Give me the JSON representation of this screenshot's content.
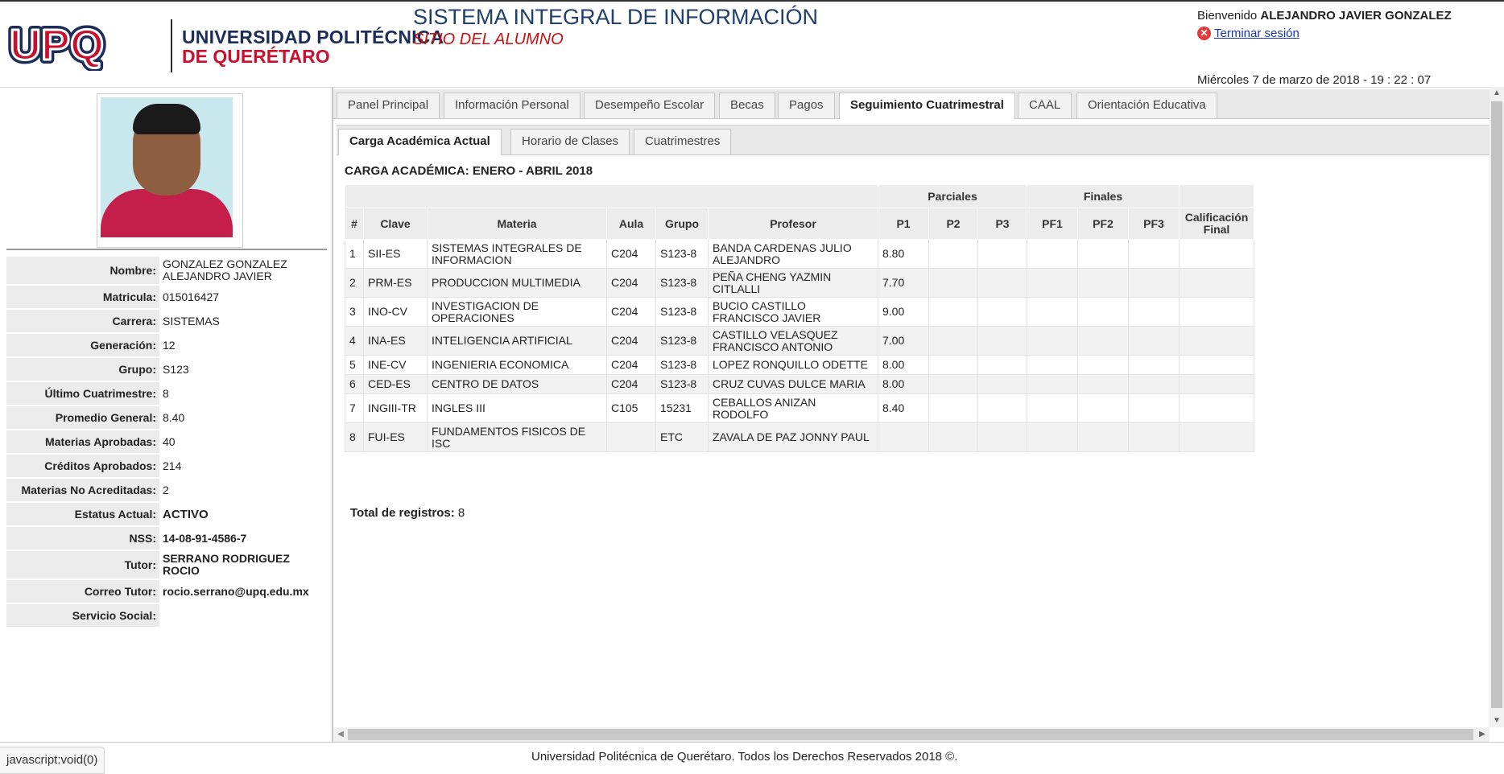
{
  "header": {
    "logo_upq": "UPQ",
    "logo_line1": "UNIVERSIDAD POLITÉCNICA",
    "logo_line2": "DE QUERÉTARO",
    "system_title": "SISTEMA INTEGRAL DE INFORMACIÓN",
    "system_subtitle": "SITIO DEL ALUMNO",
    "welcome_label": "Bienvenido",
    "welcome_user": "ALEJANDRO JAVIER GONZALEZ",
    "logout_label": "Terminar sesión",
    "datetime": "Miércoles 7 de marzo de 2018 - 19 : 22 : 07",
    "colors": {
      "title": "#1f3f6e",
      "subtitle": "#cc1111",
      "brand_red": "#c8102e",
      "brand_navy": "#1c2d5a"
    }
  },
  "profile": {
    "fields": [
      {
        "label": "Nombre:",
        "value": "GONZALEZ GONZALEZ ALEJANDRO JAVIER"
      },
      {
        "label": "Matricula:",
        "value": "015016427"
      },
      {
        "label": "Carrera:",
        "value": "SISTEMAS"
      },
      {
        "label": "Generación:",
        "value": "12"
      },
      {
        "label": "Grupo:",
        "value": "S123"
      },
      {
        "label": "Último Cuatrimestre:",
        "value": "8"
      },
      {
        "label": "Promedio General:",
        "value": "8.40"
      },
      {
        "label": "Materias Aprobadas:",
        "value": "40"
      },
      {
        "label": "Créditos Aprobados:",
        "value": "214"
      },
      {
        "label": "Materias No Acreditadas:",
        "value": "2"
      },
      {
        "label": "Estatus Actual:",
        "value": "ACTIVO"
      },
      {
        "label": "NSS:",
        "value": "14-08-91-4586-7"
      },
      {
        "label": "Tutor:",
        "value": "SERRANO RODRIGUEZ ROCIO"
      },
      {
        "label": "Correo Tutor:",
        "value": "rocio.serrano@upq.edu.mx"
      },
      {
        "label": "Servicio Social:",
        "value": ""
      }
    ]
  },
  "main_tabs": [
    {
      "label": "Panel Principal"
    },
    {
      "label": "Información Personal"
    },
    {
      "label": "Desempeño Escolar"
    },
    {
      "label": "Becas"
    },
    {
      "label": "Pagos"
    },
    {
      "label": "Seguimiento Cuatrimestral",
      "active": true
    },
    {
      "label": "CAAL"
    },
    {
      "label": "Orientación Educativa"
    }
  ],
  "sub_tabs": [
    {
      "label": "Carga Académica Actual",
      "active": true
    },
    {
      "label": "Horario de Clases"
    },
    {
      "label": "Cuatrimestres"
    }
  ],
  "carga": {
    "title": "CARGA ACADÉMICA: ENERO - ABRIL 2018",
    "group_headers": {
      "parciales": "Parciales",
      "finales": "Finales"
    },
    "columns": [
      "#",
      "Clave",
      "Materia",
      "Aula",
      "Grupo",
      "Profesor",
      "P1",
      "P2",
      "P3",
      "PF1",
      "PF2",
      "PF3",
      "Calificación Final"
    ],
    "rows": [
      [
        "1",
        "SII-ES",
        "SISTEMAS INTEGRALES DE INFORMACION",
        "C204",
        "S123-8",
        "BANDA CARDENAS JULIO ALEJANDRO",
        "8.80",
        "",
        "",
        "",
        "",
        "",
        ""
      ],
      [
        "2",
        "PRM-ES",
        "PRODUCCION MULTIMEDIA",
        "C204",
        "S123-8",
        "PEÑA CHENG YAZMIN CITLALLI",
        "7.70",
        "",
        "",
        "",
        "",
        "",
        ""
      ],
      [
        "3",
        "INO-CV",
        "INVESTIGACION DE OPERACIONES",
        "C204",
        "S123-8",
        "BUCIO CASTILLO FRANCISCO JAVIER",
        "9.00",
        "",
        "",
        "",
        "",
        "",
        ""
      ],
      [
        "4",
        "INA-ES",
        "INTELIGENCIA ARTIFICIAL",
        "C204",
        "S123-8",
        "CASTILLO VELASQUEZ FRANCISCO ANTONIO",
        "7.00",
        "",
        "",
        "",
        "",
        "",
        ""
      ],
      [
        "5",
        "INE-CV",
        "INGENIERIA ECONOMICA",
        "C204",
        "S123-8",
        "LOPEZ RONQUILLO ODETTE",
        "8.00",
        "",
        "",
        "",
        "",
        "",
        ""
      ],
      [
        "6",
        "CED-ES",
        "CENTRO DE DATOS",
        "C204",
        "S123-8",
        "CRUZ CUVAS DULCE MARIA",
        "8.00",
        "",
        "",
        "",
        "",
        "",
        ""
      ],
      [
        "7",
        "INGIII-TR",
        "INGLES III",
        "C105",
        "15231",
        "CEBALLOS ANIZAN RODOLFO",
        "8.40",
        "",
        "",
        "",
        "",
        "",
        ""
      ],
      [
        "8",
        "FUI-ES",
        "FUNDAMENTOS FISICOS DE ISC",
        "",
        "ETC",
        "ZAVALA DE PAZ JONNY PAUL",
        "",
        "",
        "",
        "",
        "",
        "",
        ""
      ]
    ],
    "total_label": "Total de registros:",
    "total_value": "8"
  },
  "footer": {
    "text": "Universidad Politécnica de Querétaro. Todos los Derechos Reservados 2018 ©.",
    "status_url": "javascript:void(0)"
  }
}
